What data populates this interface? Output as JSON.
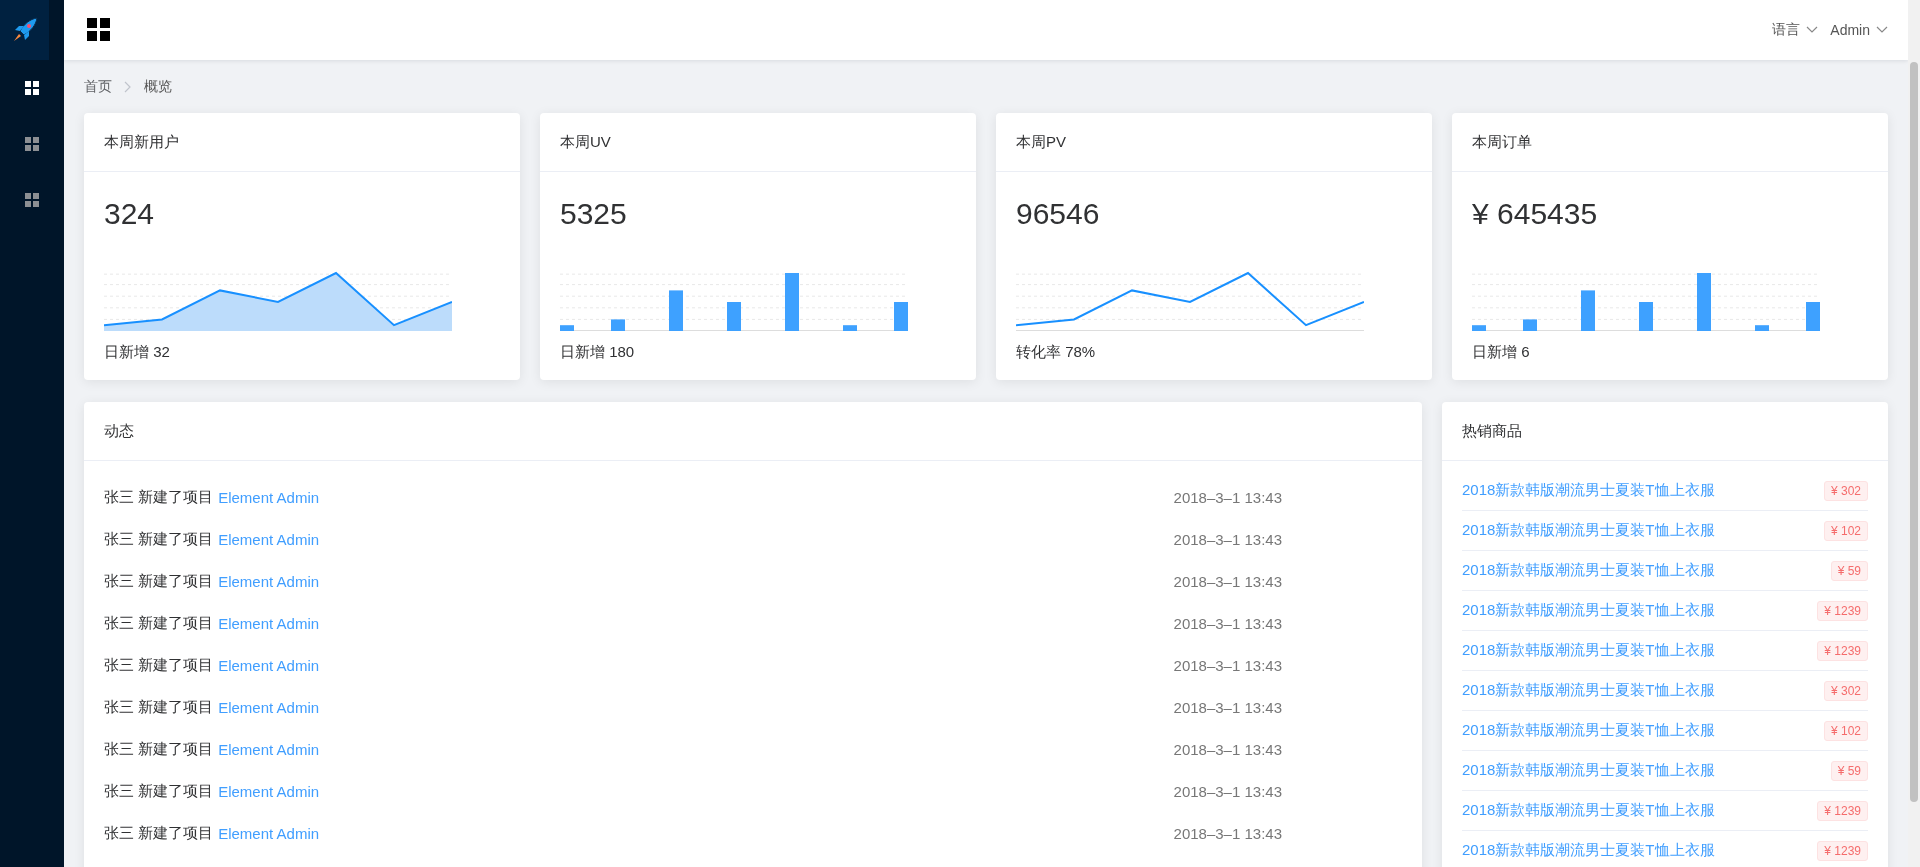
{
  "sidebar": {
    "items": [
      {
        "selected": true
      },
      {
        "selected": false
      },
      {
        "selected": false
      }
    ]
  },
  "header": {
    "language": "语言",
    "user": "Admin"
  },
  "breadcrumb": [
    "首页",
    "概览"
  ],
  "stats": [
    {
      "title": "本周新用户",
      "value": "324",
      "kind": "area",
      "footer": "日新增 32"
    },
    {
      "title": "本周UV",
      "value": "5325",
      "kind": "bar",
      "footer": "日新增 180"
    },
    {
      "title": "本周PV",
      "value": "96546",
      "kind": "line",
      "footer": "转化率 78%"
    },
    {
      "title": "本周订单",
      "value": "¥ 645435",
      "kind": "bar",
      "footer": "日新增 6"
    }
  ],
  "activity": {
    "title": "动态",
    "rows": [
      {
        "user": "张三",
        "action": "新建了项目",
        "project": "Element Admin",
        "time": "2018–3–1 13:43"
      },
      {
        "user": "张三",
        "action": "新建了项目",
        "project": "Element Admin",
        "time": "2018–3–1 13:43"
      },
      {
        "user": "张三",
        "action": "新建了项目",
        "project": "Element Admin",
        "time": "2018–3–1 13:43"
      },
      {
        "user": "张三",
        "action": "新建了项目",
        "project": "Element Admin",
        "time": "2018–3–1 13:43"
      },
      {
        "user": "张三",
        "action": "新建了项目",
        "project": "Element Admin",
        "time": "2018–3–1 13:43"
      },
      {
        "user": "张三",
        "action": "新建了项目",
        "project": "Element Admin",
        "time": "2018–3–1 13:43"
      },
      {
        "user": "张三",
        "action": "新建了项目",
        "project": "Element Admin",
        "time": "2018–3–1 13:43"
      },
      {
        "user": "张三",
        "action": "新建了项目",
        "project": "Element Admin",
        "time": "2018–3–1 13:43"
      },
      {
        "user": "张三",
        "action": "新建了项目",
        "project": "Element Admin",
        "time": "2018–3–1 13:43"
      }
    ]
  },
  "hot": {
    "title": "热销商品",
    "items": [
      {
        "name": "2018新款韩版潮流男士夏装T恤上衣服",
        "price": "¥ 302"
      },
      {
        "name": "2018新款韩版潮流男士夏装T恤上衣服",
        "price": "¥ 102"
      },
      {
        "name": "2018新款韩版潮流男士夏装T恤上衣服",
        "price": "¥ 59"
      },
      {
        "name": "2018新款韩版潮流男士夏装T恤上衣服",
        "price": "¥ 1239"
      },
      {
        "name": "2018新款韩版潮流男士夏装T恤上衣服",
        "price": "¥ 1239"
      },
      {
        "name": "2018新款韩版潮流男士夏装T恤上衣服",
        "price": "¥ 302"
      },
      {
        "name": "2018新款韩版潮流男士夏装T恤上衣服",
        "price": "¥ 102"
      },
      {
        "name": "2018新款韩版潮流男士夏装T恤上衣服",
        "price": "¥ 59"
      },
      {
        "name": "2018新款韩版潮流男士夏装T恤上衣服",
        "price": "¥ 1239"
      },
      {
        "name": "2018新款韩版潮流男士夏装T恤上衣服",
        "price": "¥ 1239"
      }
    ]
  }
}
